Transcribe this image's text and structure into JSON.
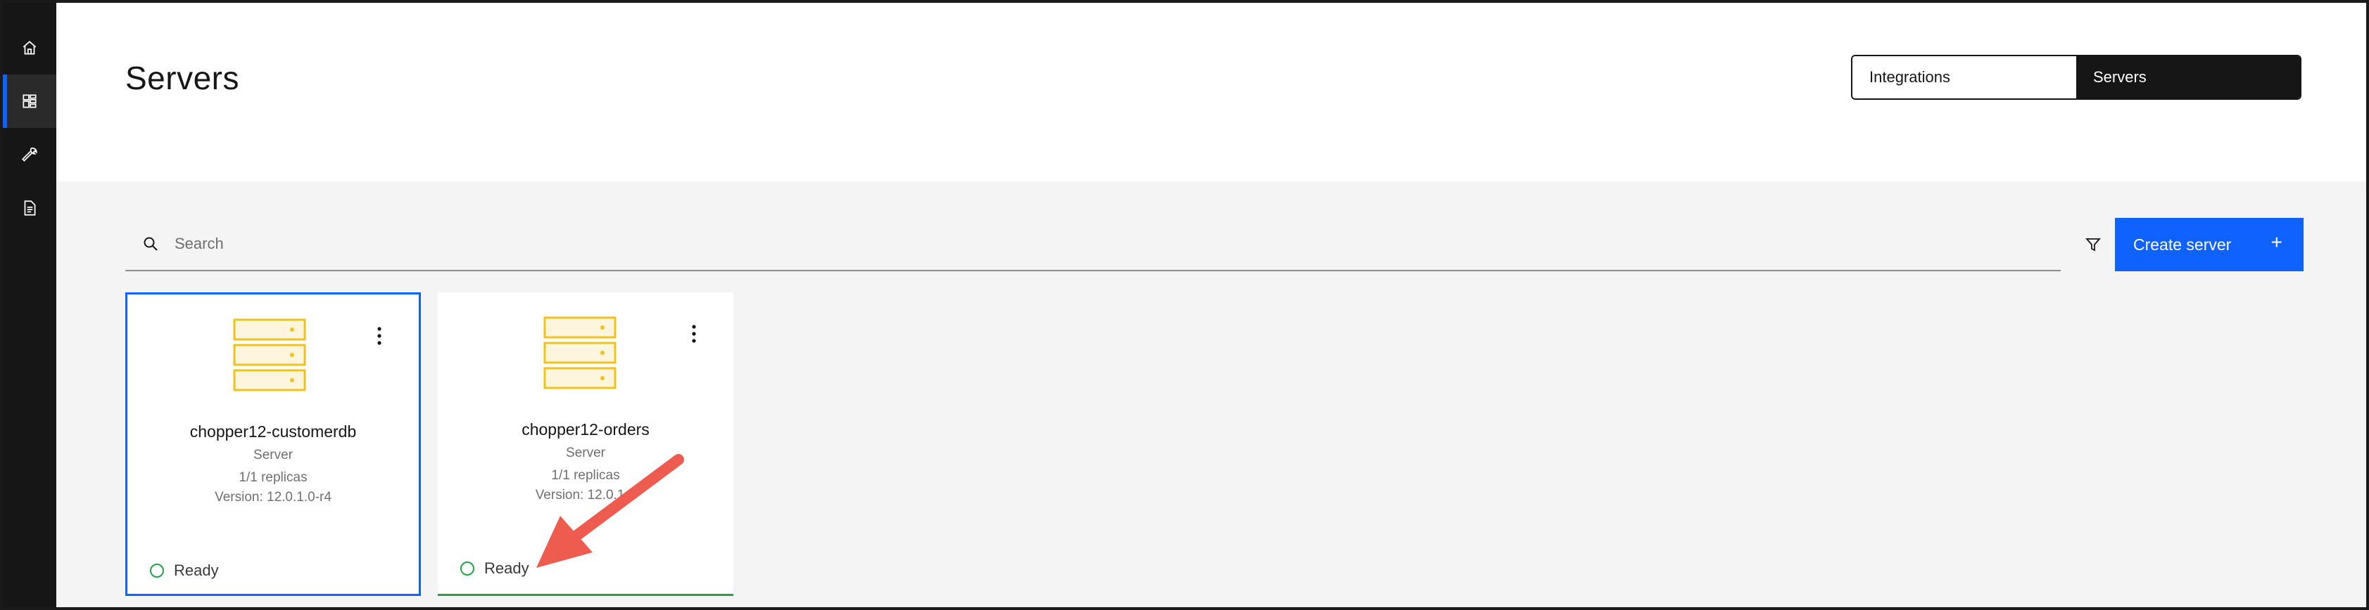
{
  "sidebar": {
    "items": [
      {
        "icon": "home-icon",
        "active": false
      },
      {
        "icon": "dashboard-icon",
        "active": true
      },
      {
        "icon": "wrench-icon",
        "active": false
      },
      {
        "icon": "document-icon",
        "active": false
      }
    ]
  },
  "header": {
    "title": "Servers",
    "switcher": {
      "integrations_label": "Integrations",
      "servers_label": "Servers"
    }
  },
  "toolbar": {
    "search_placeholder": "Search",
    "create_label": "Create server",
    "create_icon": "+"
  },
  "cards": [
    {
      "name": "chopper12-customerdb",
      "type": "Server",
      "replicas": "1/1 replicas",
      "version": "Version: 12.0.1.0-r4",
      "status": "Ready"
    },
    {
      "name": "chopper12-orders",
      "type": "Server",
      "replicas": "1/1 replicas",
      "version": "Version: 12.0.1.0",
      "status": "Ready"
    }
  ],
  "colors": {
    "accent": "#0f62fe",
    "server_icon": "#f1c21b",
    "ready": "#24a148",
    "annotation_arrow": "#ee5b4f"
  }
}
